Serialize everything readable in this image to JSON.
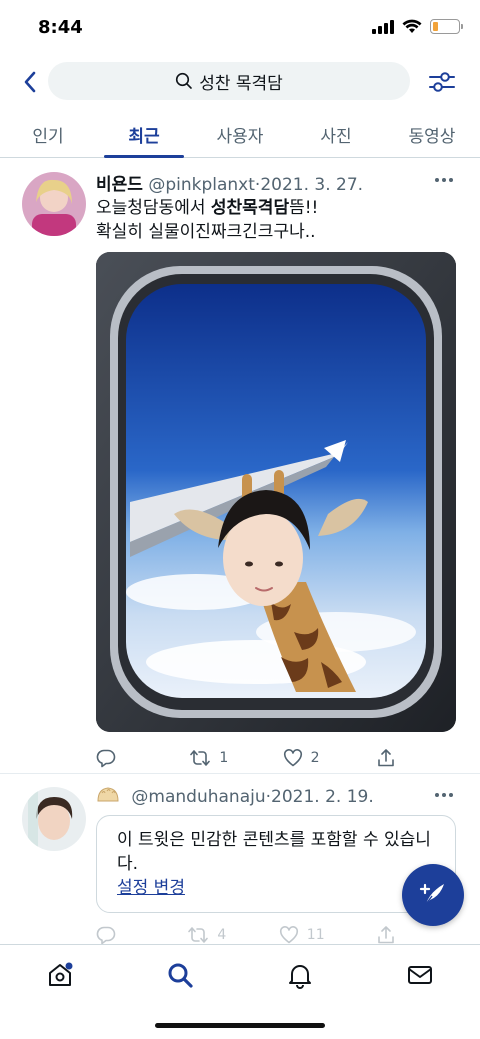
{
  "status_bar": {
    "time": "8:44"
  },
  "search": {
    "query": "성찬 목격담"
  },
  "tabs": [
    {
      "label": "인기",
      "active": false
    },
    {
      "label": "최근",
      "active": true
    },
    {
      "label": "사용자",
      "active": false
    },
    {
      "label": "사진",
      "active": false
    },
    {
      "label": "동영상",
      "active": false
    }
  ],
  "tweets": [
    {
      "display_name": "비욘드",
      "handle": "@pinkplanxt",
      "separator": "·",
      "date": "2021. 3. 27.",
      "text_line1_prefix": "오늘청담동에서 ",
      "text_line1_bold": "성찬목격담",
      "text_line1_suffix": "뜸!!",
      "text_line2": "확실히 실물이진짜크긴크구나..",
      "retweets": "1",
      "likes": "2"
    },
    {
      "display_name": "",
      "handle": "@manduhanaju",
      "separator": "·",
      "date": "2021. 2. 19.",
      "notice_text": "이 트윗은 민감한 콘텐츠를 포함할 수 있습니다.",
      "notice_link": "설정 변경",
      "retweets": "4",
      "likes": "11"
    }
  ],
  "colors": {
    "accent": "#1d3f9a",
    "secondary_text": "#536471",
    "divider": "#cfd9de"
  }
}
